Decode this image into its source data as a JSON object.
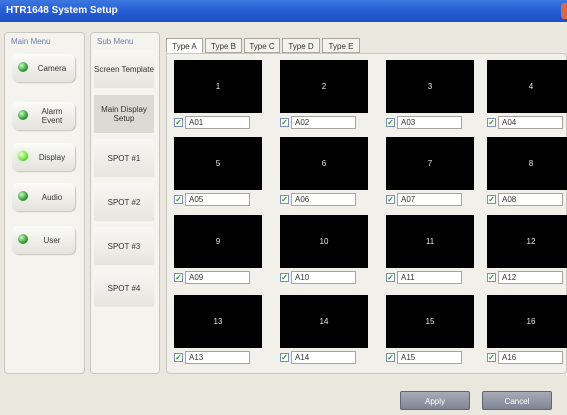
{
  "window": {
    "title": "HTR1648 System Setup"
  },
  "main_menu": {
    "header": "Main Menu",
    "items": [
      {
        "label": "Camera",
        "status_color": "#2f9e2f"
      },
      {
        "label": "Alarm Event",
        "status_color": "#2f9e2f"
      },
      {
        "label": "Display",
        "status_color": "#7de04a",
        "active": true
      },
      {
        "label": "Audio",
        "status_color": "#2f9e2f"
      },
      {
        "label": "User",
        "status_color": "#2f9e2f"
      }
    ]
  },
  "sub_menu": {
    "header": "Sub Menu",
    "items": [
      {
        "label": "Screen Template"
      },
      {
        "label": "Main Display Setup",
        "active": true
      },
      {
        "label": "SPOT #1"
      },
      {
        "label": "SPOT #2"
      },
      {
        "label": "SPOT #3"
      },
      {
        "label": "SPOT #4"
      }
    ]
  },
  "tabs": [
    {
      "label": "Type A",
      "active": true
    },
    {
      "label": "Type B"
    },
    {
      "label": "Type C"
    },
    {
      "label": "Type D"
    },
    {
      "label": "Type E"
    }
  ],
  "slots": [
    {
      "number": "1",
      "name": "A01",
      "checked": true
    },
    {
      "number": "2",
      "name": "A02",
      "checked": true
    },
    {
      "number": "3",
      "name": "A03",
      "checked": true
    },
    {
      "number": "4",
      "name": "A04",
      "checked": true
    },
    {
      "number": "5",
      "name": "A05",
      "checked": true
    },
    {
      "number": "6",
      "name": "A06",
      "checked": true
    },
    {
      "number": "7",
      "name": "A07",
      "checked": true
    },
    {
      "number": "8",
      "name": "A08",
      "checked": true
    },
    {
      "number": "9",
      "name": "A09",
      "checked": true
    },
    {
      "number": "10",
      "name": "A10",
      "checked": true
    },
    {
      "number": "11",
      "name": "A11",
      "checked": true
    },
    {
      "number": "12",
      "name": "A12",
      "checked": true
    },
    {
      "number": "13",
      "name": "A13",
      "checked": true
    },
    {
      "number": "14",
      "name": "A14",
      "checked": true
    },
    {
      "number": "15",
      "name": "A15",
      "checked": true
    },
    {
      "number": "16",
      "name": "A16",
      "checked": true
    }
  ],
  "footer": {
    "apply_label": "Apply",
    "cancel_label": "Cancel"
  }
}
